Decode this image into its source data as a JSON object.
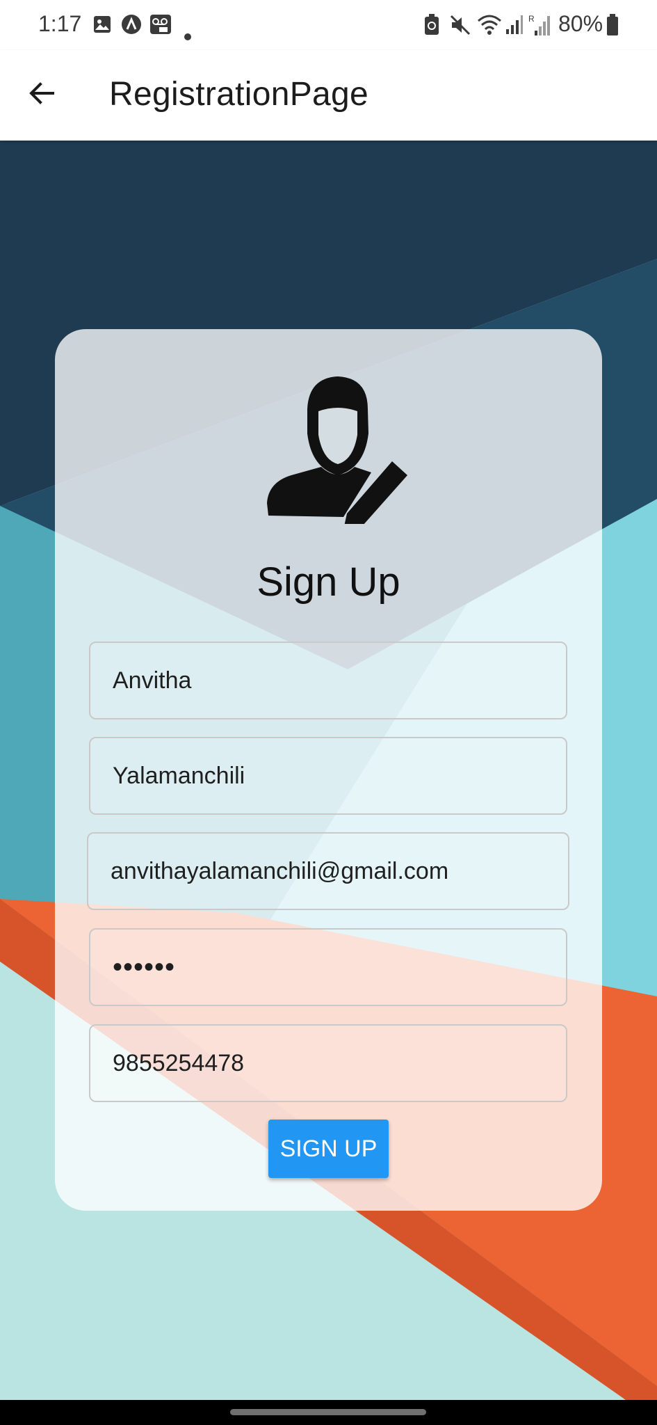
{
  "status_bar": {
    "time": "1:17",
    "battery": "80%",
    "icons": [
      "gallery-icon",
      "app-icon",
      "voicemail-icon",
      "notification-dot-icon",
      "battery-saver-icon",
      "mute-icon",
      "wifi-icon",
      "signal-icon",
      "roaming-signal-icon",
      "battery-icon"
    ]
  },
  "app_bar": {
    "title": "RegistrationPage",
    "back_icon": "arrow-back-icon"
  },
  "form": {
    "avatar_icon": "user-edit-icon",
    "title": "Sign Up",
    "fields": {
      "first_name": "Anvitha",
      "last_name": "Yalamanchili",
      "email": "anvithayalamanchili@gmail.com",
      "password": "••••••",
      "phone": "9855254478"
    },
    "submit_label": "SIGN UP"
  },
  "colors": {
    "accent": "#2196f3",
    "bg_dark_navy": "#1e3b51",
    "bg_teal": "#4ea8b8",
    "bg_light_cyan": "#7fd3de",
    "bg_pale_cyan": "#b9e4e2",
    "bg_orange": "#ec6433"
  }
}
